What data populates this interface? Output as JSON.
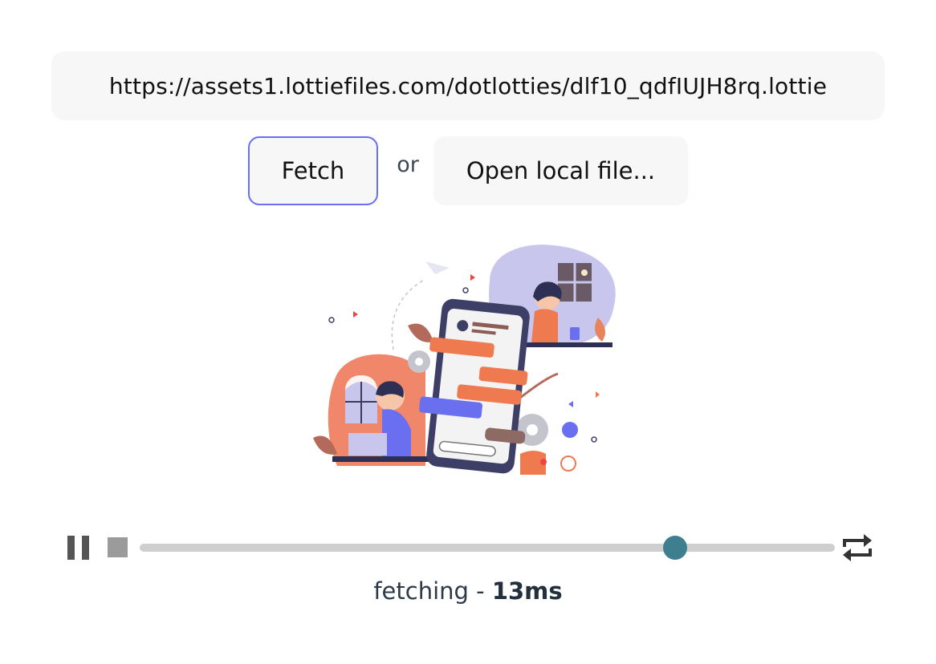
{
  "url_bar": {
    "value": "https://assets1.lottiefiles.com/dotlotties/dlf10_qdfIUJH8rq.lottie"
  },
  "actions": {
    "fetch_label": "Fetch",
    "separator": "or",
    "open_local_label": "Open local file..."
  },
  "player": {
    "progress": 0.77,
    "icons": {
      "play_pause": "pause-icon",
      "stop": "stop-icon",
      "loop": "loop-icon"
    }
  },
  "status": {
    "state": "fetching",
    "separator": " - ",
    "time": "13ms"
  },
  "colors": {
    "accent_border": "#6a6ff0",
    "thumb": "#3d7f8f",
    "track": "#cfcfcf"
  }
}
